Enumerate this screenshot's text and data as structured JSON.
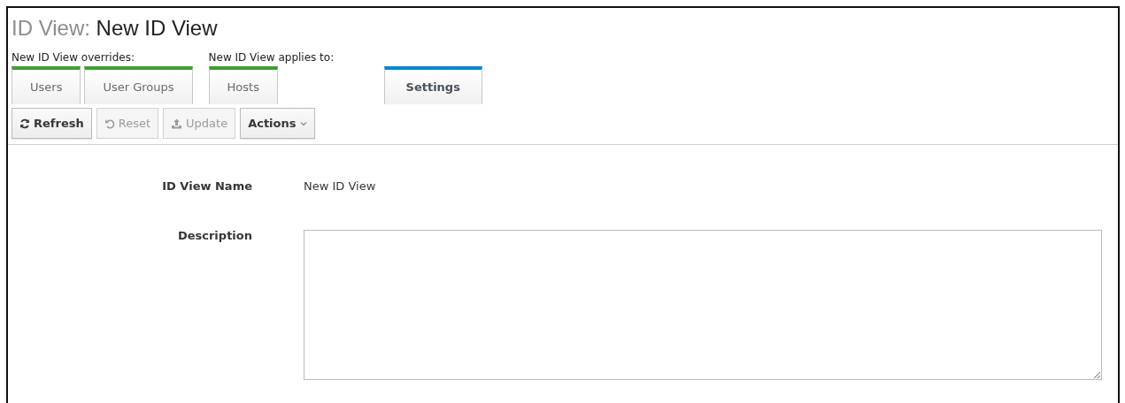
{
  "title": {
    "prefix": "ID View:",
    "name": "New ID View"
  },
  "tab_groups": [
    {
      "label": "New ID View overrides:",
      "tabs": [
        {
          "label": "Users",
          "selected": false
        },
        {
          "label": "User Groups",
          "selected": false
        }
      ]
    },
    {
      "label": "New ID View applies to:",
      "tabs": [
        {
          "label": "Hosts",
          "selected": false
        }
      ]
    },
    {
      "tabs": [
        {
          "label": "Settings",
          "selected": true
        }
      ]
    }
  ],
  "toolbar": [
    {
      "label": "Refresh",
      "kind": "refresh",
      "disabled": false
    },
    {
      "label": "Reset",
      "kind": "reset",
      "disabled": true
    },
    {
      "label": "Update",
      "kind": "update",
      "disabled": true
    },
    {
      "label": "Actions",
      "kind": "dropdown",
      "disabled": false
    }
  ],
  "fields": [
    {
      "label": "ID View Name",
      "kind": "text",
      "value": "New ID View"
    },
    {
      "label": "Description",
      "kind": "textarea"
    }
  ]
}
